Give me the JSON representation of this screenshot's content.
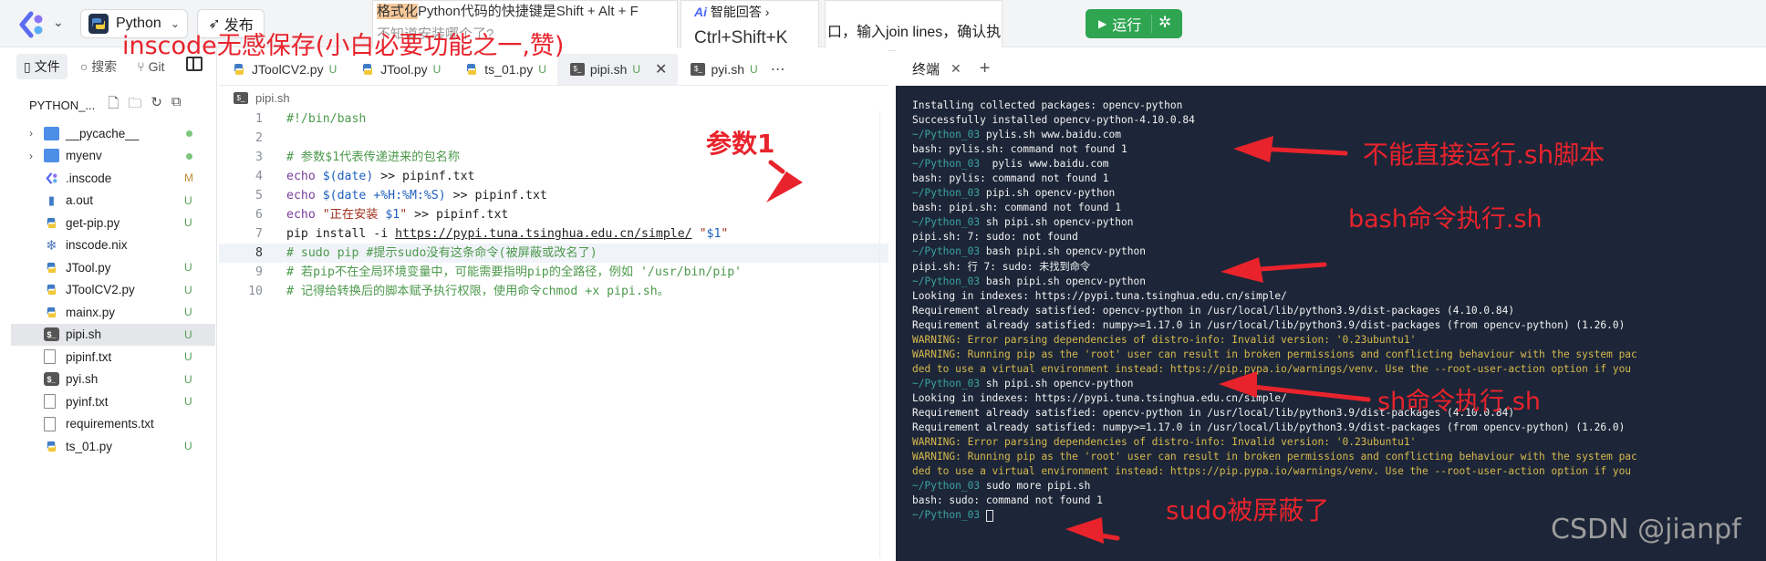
{
  "topbar": {
    "project_label": "Python",
    "publish_label": "发布",
    "run_label": "运行",
    "tip1": {
      "highlight": "格式化",
      "line1_rest": "Python代码的快捷键是Shift + Alt + F",
      "line2": "不知道安装哪个了?"
    },
    "tip2": {
      "ai_label": "智能回答",
      "ai_prefix": "Ai",
      "shortcut": "Ctrl+Shift+K"
    },
    "tip3": "口，输入join lines，确认执"
  },
  "sidebar": {
    "tabs": [
      {
        "label": "文件"
      },
      {
        "label": "搜索"
      },
      {
        "label": "Git"
      }
    ],
    "header": "PYTHON_...",
    "items": [
      {
        "name": "__pycache__",
        "type": "folder",
        "status": "dot"
      },
      {
        "name": "myenv",
        "type": "folder",
        "status": "dot"
      },
      {
        "name": ".inscode",
        "type": "inscode",
        "status": "M"
      },
      {
        "name": "a.out",
        "type": "file",
        "status": "U"
      },
      {
        "name": "get-pip.py",
        "type": "py",
        "status": "U"
      },
      {
        "name": "inscode.nix",
        "type": "nix",
        "status": ""
      },
      {
        "name": "JTool.py",
        "type": "py",
        "status": "U"
      },
      {
        "name": "JToolCV2.py",
        "type": "py",
        "status": "U"
      },
      {
        "name": "mainx.py",
        "type": "py",
        "status": "U"
      },
      {
        "name": "pipi.sh",
        "type": "sh",
        "status": "U"
      },
      {
        "name": "pipinf.txt",
        "type": "txt",
        "status": "U"
      },
      {
        "name": "pyi.sh",
        "type": "sh",
        "status": "U"
      },
      {
        "name": "pyinf.txt",
        "type": "txt",
        "status": "U"
      },
      {
        "name": "requirements.txt",
        "type": "txt",
        "status": ""
      },
      {
        "name": "ts_01.py",
        "type": "py",
        "status": "U"
      }
    ],
    "selected": "pipi.sh"
  },
  "editor": {
    "tabs": [
      {
        "label": "JToolCV2.py",
        "status": "U",
        "icon": "py"
      },
      {
        "label": "JTool.py",
        "status": "U",
        "icon": "py"
      },
      {
        "label": "ts_01.py",
        "status": "U",
        "icon": "py"
      },
      {
        "label": "pipi.sh",
        "status": "U",
        "icon": "sh",
        "active": true
      },
      {
        "label": "pyi.sh",
        "status": "U",
        "icon": "sh"
      }
    ],
    "more": "⋯",
    "breadcrumb": "pipi.sh",
    "lines": [
      "1",
      "2",
      "3",
      "4",
      "5",
      "6",
      "7",
      "8",
      "9",
      "10"
    ]
  },
  "terminal": {
    "tab_label": "终端",
    "prompt": "~/Python_03",
    "lines": [
      {
        "t": "out",
        "text": "Installing collected packages: opencv-python"
      },
      {
        "t": "out",
        "text": "Successfully installed opencv-python-4.10.0.84"
      },
      {
        "t": "cmd",
        "text": " pylis.sh www.baidu.com"
      },
      {
        "t": "out",
        "text": "bash: pylis.sh: command not found 1"
      },
      {
        "t": "cmd",
        "text": "  pylis www.baidu.com"
      },
      {
        "t": "out",
        "text": "bash: pylis: command not found 1"
      },
      {
        "t": "cmd",
        "text": " pipi.sh opencv-python"
      },
      {
        "t": "out",
        "text": "bash: pipi.sh: command not found 1"
      },
      {
        "t": "cmd",
        "text": " sh pipi.sh opencv-python"
      },
      {
        "t": "out",
        "text": "pipi.sh: 7: sudo: not found"
      },
      {
        "t": "cmd",
        "text": " bash pipi.sh opencv-python"
      },
      {
        "t": "out",
        "text": "pipi.sh: 行 7: sudo: 未找到命令"
      },
      {
        "t": "cmd",
        "text": " bash pipi.sh opencv-python"
      },
      {
        "t": "out",
        "text": "Looking in indexes: https://pypi.tuna.tsinghua.edu.cn/simple/"
      },
      {
        "t": "out",
        "text": "Requirement already satisfied: opencv-python in /usr/local/lib/python3.9/dist-packages (4.10.0.84)"
      },
      {
        "t": "out",
        "text": "Requirement already satisfied: numpy>=1.17.0 in /usr/local/lib/python3.9/dist-packages (from opencv-python) (1.26.0)"
      },
      {
        "t": "warn",
        "text": "WARNING: Error parsing dependencies of distro-info: Invalid version: '0.23ubuntu1'"
      },
      {
        "t": "warn",
        "text": "WARNING: Running pip as the 'root' user can result in broken permissions and conflicting behaviour with the system pac"
      },
      {
        "t": "warn",
        "text": "ded to use a virtual environment instead: https://pip.pypa.io/warnings/venv. Use the --root-user-action option if you"
      },
      {
        "t": "cmd",
        "text": " sh pipi.sh opencv-python"
      },
      {
        "t": "out",
        "text": "Looking in indexes: https://pypi.tuna.tsinghua.edu.cn/simple/"
      },
      {
        "t": "out",
        "text": "Requirement already satisfied: opencv-python in /usr/local/lib/python3.9/dist-packages (4.10.0.84)"
      },
      {
        "t": "out",
        "text": "Requirement already satisfied: numpy>=1.17.0 in /usr/local/lib/python3.9/dist-packages (from opencv-python) (1.26.0)"
      },
      {
        "t": "warn",
        "text": "WARNING: Error parsing dependencies of distro-info: Invalid version: '0.23ubuntu1'"
      },
      {
        "t": "warn",
        "text": "WARNING: Running pip as the 'root' user can result in broken permissions and conflicting behaviour with the system pac"
      },
      {
        "t": "warn",
        "text": "ded to use a virtual environment instead: https://pip.pypa.io/warnings/venv. Use the --root-user-action option if you"
      },
      {
        "t": "cmd",
        "text": " sudo more pipi.sh"
      },
      {
        "t": "out",
        "text": "bash: sudo: command not found 1"
      },
      {
        "t": "cmd",
        "text": " "
      }
    ]
  },
  "annotations": {
    "inscode": "inscode无感保存(小白必要功能之一,赞)",
    "param": "参数1",
    "cannot_run": "不能直接运行.sh脚本",
    "bash_run": "bash命令执行.sh",
    "sh_run": "sh命令执行.sh",
    "sudo_blocked": "sudo被屏蔽了",
    "color": "#e8232c"
  },
  "watermark": "CSDN @jianpf",
  "colors": {
    "run": "#2fa552",
    "term_bg": "#1d2638",
    "warn": "#d7b94c"
  }
}
